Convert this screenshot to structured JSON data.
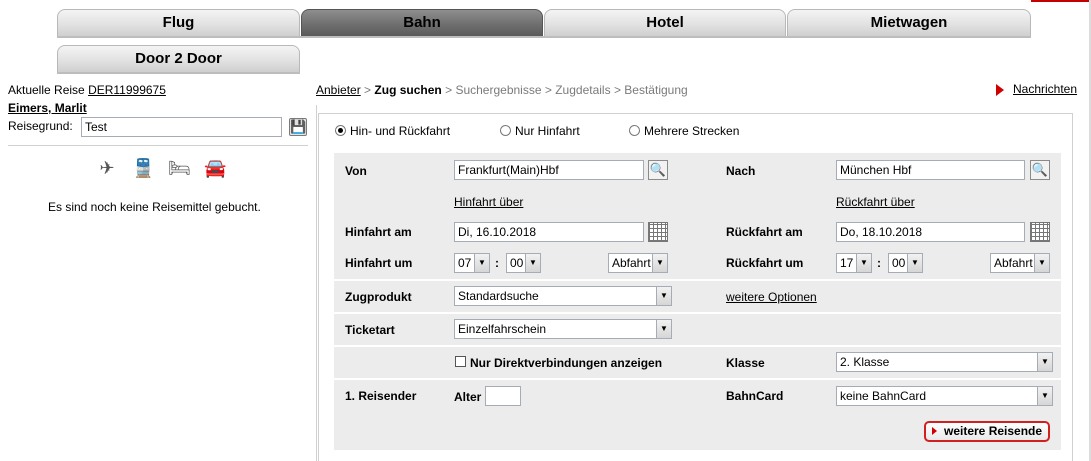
{
  "tabs": [
    {
      "label": "Flug"
    },
    {
      "label": "Bahn"
    },
    {
      "label": "Hotel"
    },
    {
      "label": "Mietwagen"
    },
    {
      "label": "Door 2 Door"
    }
  ],
  "colors": {
    "accent": "#d00000",
    "band": "#ececec",
    "active_tab": "#6f6f6f"
  },
  "left": {
    "current_trip_label": "Aktuelle Reise",
    "current_trip_id": "DER11999675",
    "traveler_name": "Eimers, Marlit",
    "reason_label": "Reisegrund:",
    "reason_value": "Test",
    "icons": [
      "airplane-icon",
      "train-icon",
      "hotel-bed-icon",
      "car-icon"
    ],
    "empty_text": "Es sind noch keine Reisemittel gebucht."
  },
  "breadcrumb": {
    "step1": "Anbieter",
    "sep": ">",
    "step2": "Zug suchen",
    "step3": "Suchergebnisse",
    "step4": "Zugdetails",
    "step5": "Bestätigung"
  },
  "messages_link": "Nachrichten",
  "trip_type": {
    "options": [
      "Hin- und Rückfahrt",
      "Nur Hinfahrt",
      "Mehrere Strecken"
    ],
    "selected": "Hin- und Rückfahrt"
  },
  "form": {
    "from_label": "Von",
    "from_value": "Frankfurt(Main)Hbf",
    "to_label": "Nach",
    "to_value": "München Hbf",
    "via_out_link": "Hinfahrt über",
    "via_return_link": "Rückfahrt über",
    "out_date_label": "Hinfahrt am",
    "out_date_value": "Di, 16.10.2018",
    "return_date_label": "Rückfahrt am",
    "return_date_value": "Do, 18.10.2018",
    "out_time_label": "Hinfahrt um",
    "out_hour": "07",
    "out_min": "00",
    "out_mode": "Abfahrt",
    "return_time_label": "Rückfahrt um",
    "return_hour": "17",
    "return_min": "00",
    "return_mode": "Abfahrt",
    "time_colon": ":",
    "product_label": "Zugprodukt",
    "product_value": "Standardsuche",
    "more_options_link": "weitere Optionen",
    "ticket_label": "Ticketart",
    "ticket_value": "Einzelfahrschein",
    "direct_only_label": "Nur Direktverbindungen anzeigen",
    "direct_only_checked": false,
    "class_label": "Klasse",
    "class_value": "2. Klasse",
    "traveler_label": "1. Reisender",
    "age_label": "Alter",
    "age_value": "",
    "bahncard_label": "BahnCard",
    "bahncard_value": "keine BahnCard",
    "more_travelers_button": "weitere Reisende"
  }
}
